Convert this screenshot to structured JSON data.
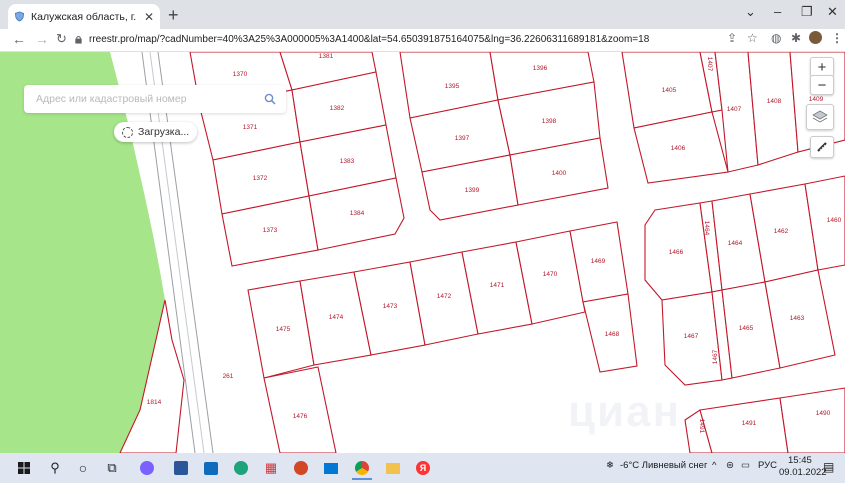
{
  "browser": {
    "tab_title": "Калужская область, г. Калуга, д.",
    "url": "rreestr.pro/map/?cadNumber=40%3A25%3A000005%3A1400&lat=54.650391875164075&lng=36.22606311689181&zoom=18",
    "new_tab": "+",
    "win_min": "–",
    "win_restore": "❐",
    "win_close": "✕",
    "collapse": "⌄"
  },
  "map": {
    "search_placeholder": "Адрес или кадастровый номер",
    "loading_text": "Загрузка...",
    "zoom_in": "+",
    "zoom_out": "−",
    "watermark": "циан",
    "plots": [
      {
        "id": "1370",
        "label": "1370"
      },
      {
        "id": "1381",
        "label": "1381"
      },
      {
        "id": "1395",
        "label": "1395"
      },
      {
        "id": "1396",
        "label": "1396"
      },
      {
        "id": "1405",
        "label": "1405"
      },
      {
        "id": "1407a",
        "label": "1407"
      },
      {
        "id": "1407b",
        "label": "1407"
      },
      {
        "id": "1408",
        "label": "1408"
      },
      {
        "id": "1409",
        "label": "1409"
      },
      {
        "id": "1371",
        "label": "1371"
      },
      {
        "id": "1382",
        "label": "1382"
      },
      {
        "id": "1397",
        "label": "1397"
      },
      {
        "id": "1398",
        "label": "1398"
      },
      {
        "id": "1406",
        "label": "1406"
      },
      {
        "id": "1372",
        "label": "1372"
      },
      {
        "id": "1383",
        "label": "1383"
      },
      {
        "id": "1399",
        "label": "1399"
      },
      {
        "id": "1400",
        "label": "1400"
      },
      {
        "id": "1373",
        "label": "1373"
      },
      {
        "id": "1384",
        "label": "1384"
      },
      {
        "id": "1466",
        "label": "1466"
      },
      {
        "id": "1464a",
        "label": "1464"
      },
      {
        "id": "1464b",
        "label": "1464"
      },
      {
        "id": "1462",
        "label": "1462"
      },
      {
        "id": "1460",
        "label": "1460"
      },
      {
        "id": "1469",
        "label": "1469"
      },
      {
        "id": "1470",
        "label": "1470"
      },
      {
        "id": "1471",
        "label": "1471"
      },
      {
        "id": "1472",
        "label": "1472"
      },
      {
        "id": "1473",
        "label": "1473"
      },
      {
        "id": "1474",
        "label": "1474"
      },
      {
        "id": "1475",
        "label": "1475"
      },
      {
        "id": "1468",
        "label": "1468"
      },
      {
        "id": "1467a",
        "label": "1467"
      },
      {
        "id": "1467b",
        "label": "1467"
      },
      {
        "id": "1465",
        "label": "1465"
      },
      {
        "id": "1463",
        "label": "1463"
      },
      {
        "id": "261",
        "label": "261"
      },
      {
        "id": "1476",
        "label": "1476"
      },
      {
        "id": "1814",
        "label": "1814"
      },
      {
        "id": "1491a",
        "label": "1491"
      },
      {
        "id": "1491b",
        "label": "1491"
      },
      {
        "id": "1490",
        "label": "1490"
      }
    ]
  },
  "taskbar": {
    "weather": "-6°C  Ливневый снег",
    "lang": "РУС",
    "time": "15:45",
    "date": "09.01.2022"
  },
  "colors": {
    "plot_border": "#c2182b",
    "green_area": "#a6e58a",
    "tabstrip": "#dee1e6",
    "taskbar": "#dfe6f2"
  }
}
